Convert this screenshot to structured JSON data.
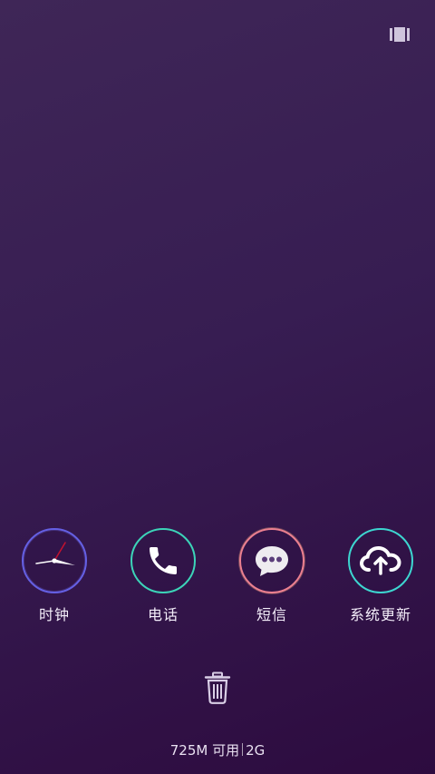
{
  "apps": [
    {
      "label": "时钟",
      "icon": "clock-icon",
      "ring_color": "#6a64e0"
    },
    {
      "label": "电话",
      "icon": "phone-icon",
      "ring_color": "#3fd6b4"
    },
    {
      "label": "短信",
      "icon": "message-icon",
      "ring_color": "#f07a90"
    },
    {
      "label": "系统更新",
      "icon": "cloud-upload-icon",
      "ring_color": "#3fd6d0"
    }
  ],
  "status": {
    "memory": "725M 可用",
    "total": "2G"
  },
  "icons": {
    "top_right": "recents-toggle-icon",
    "bottom": "trash-icon"
  }
}
